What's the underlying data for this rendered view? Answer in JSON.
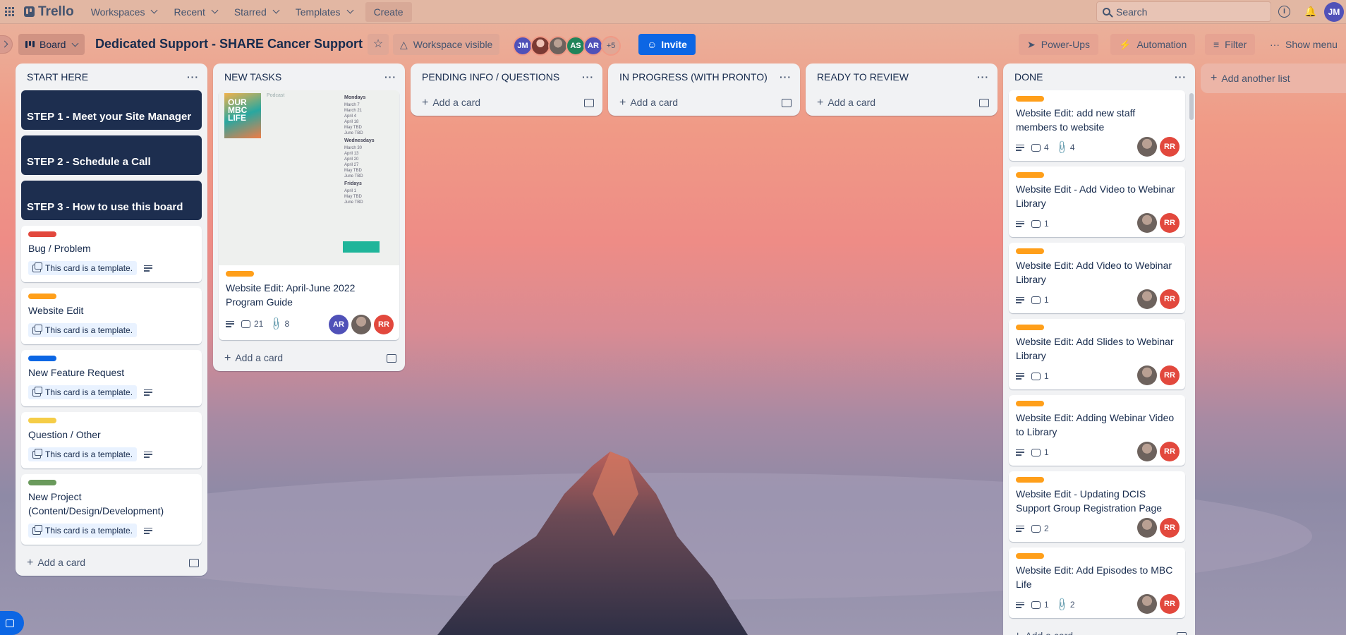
{
  "topbar": {
    "logo": "Trello",
    "nav": [
      "Workspaces",
      "Recent",
      "Starred",
      "Templates"
    ],
    "create": "Create",
    "search_placeholder": "Search",
    "user_initials": "JM"
  },
  "board": {
    "view": "Board",
    "title": "Dedicated Support - SHARE Cancer Support",
    "visibility": "Workspace visible",
    "members": [
      "JM",
      "AS",
      "AR"
    ],
    "more_members": "+5",
    "invite": "Invite",
    "power_ups": "Power-Ups",
    "automation": "Automation",
    "filter": "Filter",
    "show_menu": "Show menu",
    "add_list": "Add another list"
  },
  "colors": {
    "orange": "#ff9f1a",
    "red": "#e2483d",
    "blue": "#0c66e4",
    "yellow": "#f5cd47",
    "green": "#4bce97",
    "dark": "#1d2e4f"
  },
  "add_card": "Add a card",
  "template_badge": "This card is a template.",
  "lists": {
    "start": {
      "title": "START HERE",
      "steps": [
        "STEP 1 - Meet your Site Manager",
        "STEP 2 - Schedule a Call",
        "STEP 3 - How to use this board"
      ],
      "templates": [
        "Bug / Problem",
        "Website Edit",
        "New Feature Request",
        "Question / Other",
        "New Project (Content/Design/Development)"
      ]
    },
    "new": {
      "title": "NEW TASKS",
      "card": {
        "title": "Website Edit: April-June 2022 Program Guide",
        "comments": "21",
        "attachments": "8",
        "members": [
          "AR",
          "RR"
        ],
        "cover": {
          "podcast_title": "OUR MBC LIFE",
          "podcast_label": "Podcast",
          "days": [
            {
              "day": "Mondays",
              "dates": [
                "March 7",
                "March 21",
                "April 4",
                "April 18",
                "May TBD",
                "June TBD"
              ]
            },
            {
              "day": "Wednesdays",
              "dates": [
                "March 30",
                "April 13",
                "April 20",
                "April 27",
                "May TBD",
                "June TBD"
              ]
            },
            {
              "day": "Fridays",
              "dates": [
                "April 1",
                "May TBD",
                "June TBD"
              ]
            }
          ]
        }
      }
    },
    "pending": {
      "title": "PENDING INFO / QUESTIONS"
    },
    "progress": {
      "title": "IN PROGRESS (WITH PRONTO)"
    },
    "review": {
      "title": "READY TO REVIEW"
    },
    "done": {
      "title": "DONE",
      "cards": [
        {
          "title": "Website Edit: add new staff members to website",
          "comments": "4",
          "attachments": "4"
        },
        {
          "title": "Website Edit - Add Video to Webinar Library",
          "comments": "1"
        },
        {
          "title": "Website Edit: Add Video to Webinar Library",
          "comments": "1"
        },
        {
          "title": "Website Edit: Add Slides to Webinar Library",
          "comments": "1"
        },
        {
          "title": "Website Edit: Adding Webinar Video to Library",
          "comments": "1"
        },
        {
          "title": "Website Edit - Updating DCIS Support Group Registration Page",
          "comments": "2"
        },
        {
          "title": "Website Edit: Add Episodes to MBC Life",
          "comments": "1",
          "attachments": "2"
        }
      ],
      "member": "RR"
    }
  }
}
